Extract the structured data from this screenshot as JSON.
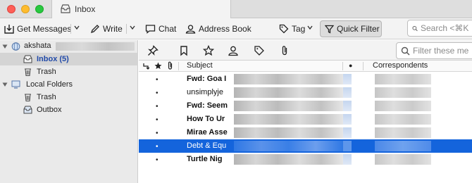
{
  "window": {
    "tab_title": "Inbox"
  },
  "toolbar": {
    "get_messages": "Get Messages",
    "write": "Write",
    "chat": "Chat",
    "address_book": "Address Book",
    "tag": "Tag",
    "quick_filter": "Quick Filter",
    "search_placeholder": "Search <⌘K"
  },
  "folders": {
    "account_name": "akshata",
    "inbox_label": "Inbox (5)",
    "trash_label": "Trash",
    "local_folders_label": "Local Folders",
    "local_trash_label": "Trash",
    "outbox_label": "Outbox"
  },
  "quick_filter_bar": {
    "filter_placeholder": "Filter these messages"
  },
  "columns": {
    "subject": "Subject",
    "unread": "●",
    "correspondents": "Correspondents"
  },
  "messages": [
    {
      "dot": "•",
      "subject": "Fwd: Goa I",
      "bold": true,
      "selected": false
    },
    {
      "dot": "•",
      "subject": "unsimplyje",
      "bold": false,
      "selected": false
    },
    {
      "dot": "•",
      "subject": "Fwd: Seem",
      "bold": true,
      "selected": false
    },
    {
      "dot": "•",
      "subject": "How To Ur",
      "bold": true,
      "selected": false
    },
    {
      "dot": "•",
      "subject": "Mirae Asse",
      "bold": true,
      "selected": false
    },
    {
      "dot": "•",
      "subject": "Debt & Equ",
      "bold": false,
      "selected": true
    },
    {
      "dot": "•",
      "subject": "Turtle Nig",
      "bold": true,
      "selected": false
    }
  ],
  "colors": {
    "selected_row": "#1464dc",
    "inbox_text": "#2049a8",
    "close": "#fe5f57",
    "minimize": "#febc2e",
    "maximize": "#28c840"
  }
}
